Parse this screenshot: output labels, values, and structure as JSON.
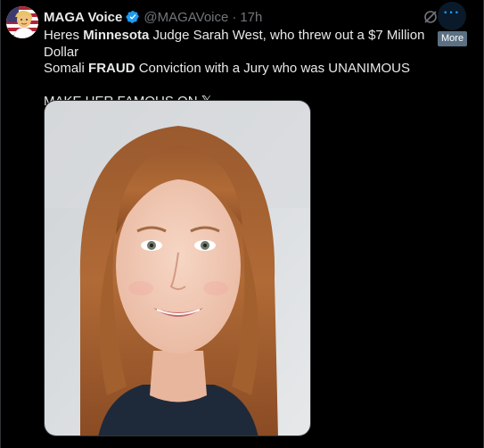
{
  "tweet": {
    "author": {
      "display_name": "MAGA Voice",
      "handle": "@MAGAVoice",
      "separator": "·",
      "time": "17h",
      "verified": true,
      "verified_color": "#1d9bf0"
    },
    "text": {
      "line1_part1": "Heres ",
      "line1_bold1": "Minnesota",
      "line1_part2": " Judge Sarah West, who threw out a $7 Million Dollar",
      "line2_part1": "Somali ",
      "line2_bold2": "FRAUD",
      "line2_part2": " Conviction with a Jury who was UNANIMOUS",
      "line3": "MAKE HER FAMOUS ON 𝕏"
    },
    "actions": {
      "grok_icon": "grok-icon",
      "more_icon": "more-icon",
      "more_dots": "···",
      "more_tooltip": "More"
    },
    "media": {
      "type": "photo",
      "subject": "portrait-photo"
    }
  }
}
